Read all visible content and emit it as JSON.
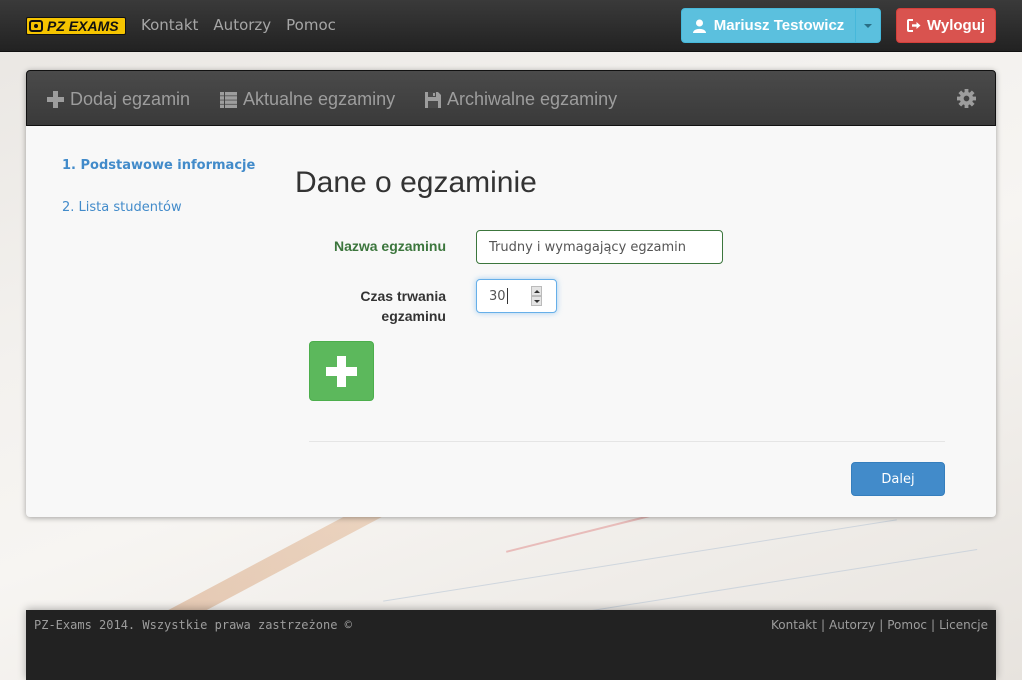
{
  "brand": {
    "logo_text": "PZ EXAMS"
  },
  "topnav": {
    "items": [
      "Kontakt",
      "Autorzy",
      "Pomoc"
    ]
  },
  "user": {
    "name": "Mariusz Testowicz",
    "icon": "user-icon"
  },
  "logout": {
    "label": "Wyloguj",
    "icon": "sign-out-icon"
  },
  "panel_nav": {
    "items": [
      {
        "label": "Dodaj egzamin",
        "icon": "plus-icon"
      },
      {
        "label": "Aktualne egzaminy",
        "icon": "list-icon"
      },
      {
        "label": "Archiwalne egzaminy",
        "icon": "floppy-disk-icon"
      }
    ],
    "settings_icon": "gear-icon"
  },
  "steps": [
    {
      "label": "1. Podstawowe informacje",
      "active": true
    },
    {
      "label": "2. Lista studentów",
      "active": false
    }
  ],
  "form": {
    "title": "Dane o egzaminie",
    "name_label": "Nazwa egzaminu",
    "name_value": "Trudny i wymagający egzamin",
    "duration_label_line1": "Czas trwania",
    "duration_label_line2": "egzaminu",
    "duration_value": "30",
    "add_icon": "plus-icon",
    "next_label": "Dalej"
  },
  "footer": {
    "copyright": "PZ-Exams 2014. Wszystkie prawa zastrzeżone ©",
    "links": [
      "Kontakt",
      "Autorzy",
      "Pomoc",
      "Licencje"
    ]
  },
  "colors": {
    "navbar": "#222222",
    "info": "#5bc0de",
    "danger": "#d9534f",
    "success": "#5cb85c",
    "primary": "#428bca",
    "valid": "#3c763d"
  }
}
